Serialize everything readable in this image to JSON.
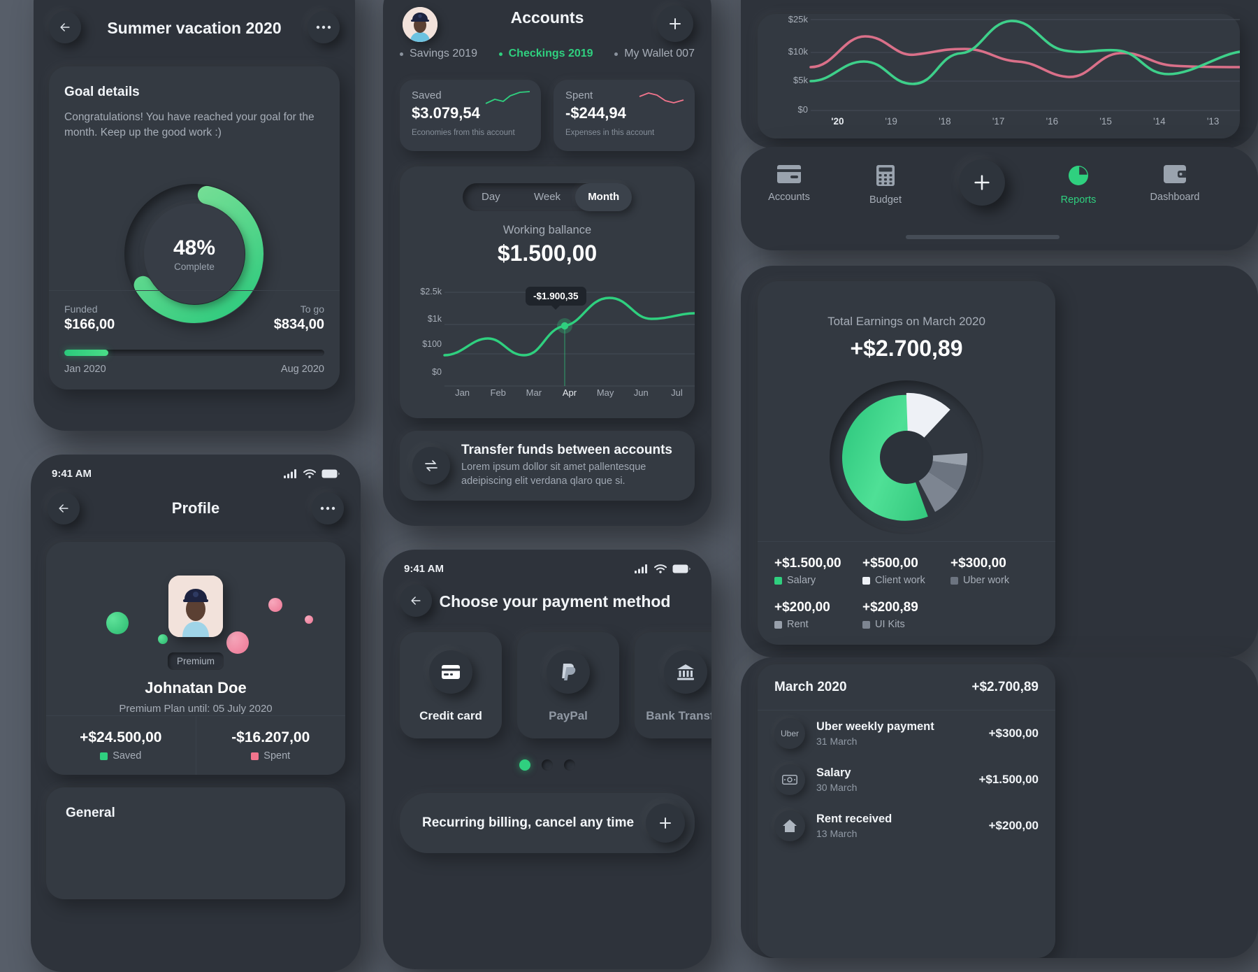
{
  "goal_screen": {
    "title": "Summer vacation 2020",
    "back_icon": "arrow-left-icon",
    "more_icon": "ellipsis-icon",
    "card_title": "Goal details",
    "description": "Congratulations! You have reached your goal for the month. Keep up the good work :)",
    "percent": "48%",
    "percent_label": "Complete",
    "funded_label": "Funded",
    "funded_value": "$166,00",
    "togo_label": "To go",
    "togo_value": "$834,00",
    "start_date": "Jan 2020",
    "end_date": "Aug 2020",
    "progress_pct": 17
  },
  "profile_screen": {
    "status_time": "9:41 AM",
    "title": "Profile",
    "badge": "Premium",
    "name": "Johnatan Doe",
    "plan": "Premium Plan until: 05 July 2020",
    "stats": [
      {
        "value": "+$24.500,00",
        "label": "Saved",
        "color": "#2fd07f"
      },
      {
        "value": "-$16.207,00",
        "label": "Spent",
        "color": "#f2748c"
      }
    ],
    "general_title": "General"
  },
  "accounts_screen": {
    "title": "Accounts",
    "add_icon": "plus-icon",
    "tabs": [
      {
        "label": "Savings 2019",
        "active": false
      },
      {
        "label": "Checkings 2019",
        "active": true
      },
      {
        "label": "My Wallet 007",
        "active": false
      }
    ],
    "mini_cards": [
      {
        "label": "Saved",
        "value": "$3.079,54",
        "sub": "Economies from this account",
        "trend": "up",
        "color": "#2fd07f"
      },
      {
        "label": "Spent",
        "value": "-$244,94",
        "sub": "Expenses in this account",
        "trend": "down",
        "color": "#f2748c"
      }
    ],
    "segments": [
      "Day",
      "Week",
      "Month"
    ],
    "segment_selected": "Month",
    "balance_label": "Working ballance",
    "balance_value": "$1.500,00",
    "tooltip_value": "-$1.900,35",
    "transfer": {
      "title": "Transfer funds between accounts",
      "desc": "Lorem ipsum dollor sit amet pallentesque adeipiscing elit verdana qlaro que si.",
      "icon": "transfer-arrows-icon"
    }
  },
  "payment_screen": {
    "status_time": "9:41 AM",
    "title": "Choose your payment method",
    "back_icon": "arrow-left-icon",
    "options": [
      {
        "label": "Credit card",
        "icon": "credit-card-icon",
        "selected": true
      },
      {
        "label": "PayPal",
        "icon": "paypal-icon",
        "selected": false
      },
      {
        "label": "Bank Transfer",
        "icon": "bank-icon",
        "selected": false
      }
    ],
    "pager": [
      true,
      false,
      false
    ],
    "recurring_label": "Recurring billing, cancel any time",
    "recurring_icon": "plus-icon"
  },
  "nav": {
    "items": [
      {
        "label": "Accounts",
        "icon": "card-icon",
        "active": false
      },
      {
        "label": "Budget",
        "icon": "calculator-icon",
        "active": false
      },
      {
        "label": "",
        "icon": "plus-icon",
        "active": false,
        "fab": true
      },
      {
        "label": "Reports",
        "icon": "pie-chart-icon",
        "active": true
      },
      {
        "label": "Dashboard",
        "icon": "wallet-icon",
        "active": false
      }
    ]
  },
  "earnings_screen": {
    "title": "Total Earnings on March 2020",
    "value": "+$2.700,89",
    "legend": [
      {
        "value": "+$1.500,00",
        "label": "Salary",
        "color": "#2fd07f"
      },
      {
        "value": "+$500,00",
        "label": "Client work",
        "color": "#eef1f6"
      },
      {
        "value": "+$300,00",
        "label": "Uber work",
        "color": "#6c7480"
      },
      {
        "value": "+$200,00",
        "label": "Rent",
        "color": "#98a0ab"
      },
      {
        "value": "+$200,89",
        "label": "UI Kits",
        "color": "#7d8591"
      }
    ]
  },
  "transactions_screen": {
    "month": "March 2020",
    "total": "+$2.700,89",
    "rows": [
      {
        "name": "Uber weekly payment",
        "date": "31 March",
        "amount": "+$300,00",
        "icon": "uber-icon"
      },
      {
        "name": "Salary",
        "date": "30 March",
        "amount": "+$1.500,00",
        "icon": "money-icon"
      },
      {
        "name": "Rent received",
        "date": "13 March",
        "amount": "+$200,00",
        "icon": "home-icon"
      }
    ]
  },
  "chart_data": [
    {
      "type": "line",
      "name": "balance-chart",
      "title": "Working ballance",
      "x": [
        "Jan",
        "Feb",
        "Mar",
        "Apr",
        "May",
        "Jun",
        "Jul"
      ],
      "series": [
        {
          "name": "Balance",
          "color": "#2fd07f",
          "values": [
            100,
            650,
            230,
            900,
            1800,
            1100,
            1400
          ]
        }
      ],
      "ytick_labels": [
        "$2.5k",
        "$1k",
        "$100",
        "$0"
      ],
      "ylim": [
        0,
        2500
      ],
      "highlight": {
        "x": "Apr",
        "label": "-$1.900,35"
      },
      "grid": true,
      "legend": "none"
    },
    {
      "type": "line",
      "name": "years-chart",
      "x": [
        "'20",
        "'19",
        "'18",
        "'17",
        "'16",
        "'15",
        "'14",
        "'13"
      ],
      "series": [
        {
          "name": "Income",
          "color": "#e8758f",
          "values": [
            7000,
            13500,
            9800,
            10500,
            8200,
            7500,
            10200,
            8000
          ]
        },
        {
          "name": "Expense",
          "color": "#3ed08a",
          "values": [
            5000,
            8000,
            5800,
            10000,
            22000,
            11000,
            6500,
            10300
          ]
        }
      ],
      "ytick_labels": [
        "$25k",
        "$10k",
        "$5k",
        "$0"
      ],
      "ylim": [
        0,
        25000
      ],
      "grid": true,
      "legend": "none"
    },
    {
      "type": "pie",
      "name": "earnings-donut",
      "title": "Total Earnings on March 2020",
      "labels": [
        "Salary",
        "Client work",
        "Uber work",
        "Rent",
        "UI Kits"
      ],
      "values": [
        1500,
        500,
        300,
        200,
        200.89
      ],
      "colors": [
        "#2fd07f",
        "#eef1f6",
        "#6c7480",
        "#98a0ab",
        "#7d8591"
      ],
      "total": "+$2.700,89"
    }
  ]
}
